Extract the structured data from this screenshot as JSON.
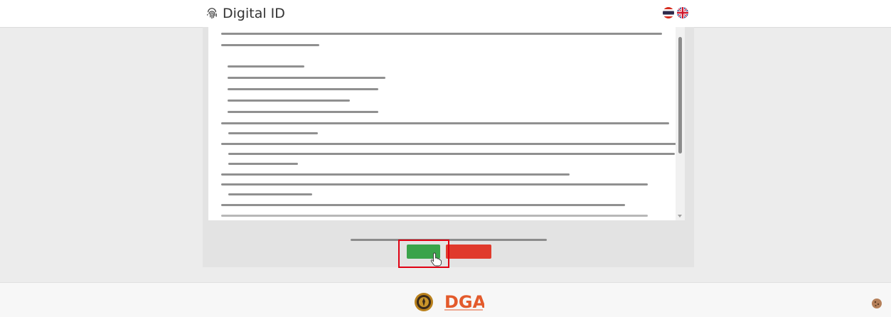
{
  "header": {
    "title": "Digital ID",
    "logo_icon": "fingerprint-icon",
    "languages": [
      "th",
      "en"
    ]
  },
  "terms": {
    "consent_text": "",
    "scroll_fraction": 0.05
  },
  "buttons": {
    "accept_label": "",
    "decline_label": "",
    "accept_color": "#3aa34a",
    "decline_color": "#e03a2c"
  },
  "footer": {
    "logo_text": "DGA"
  },
  "colors": {
    "highlight": "#e00012"
  }
}
